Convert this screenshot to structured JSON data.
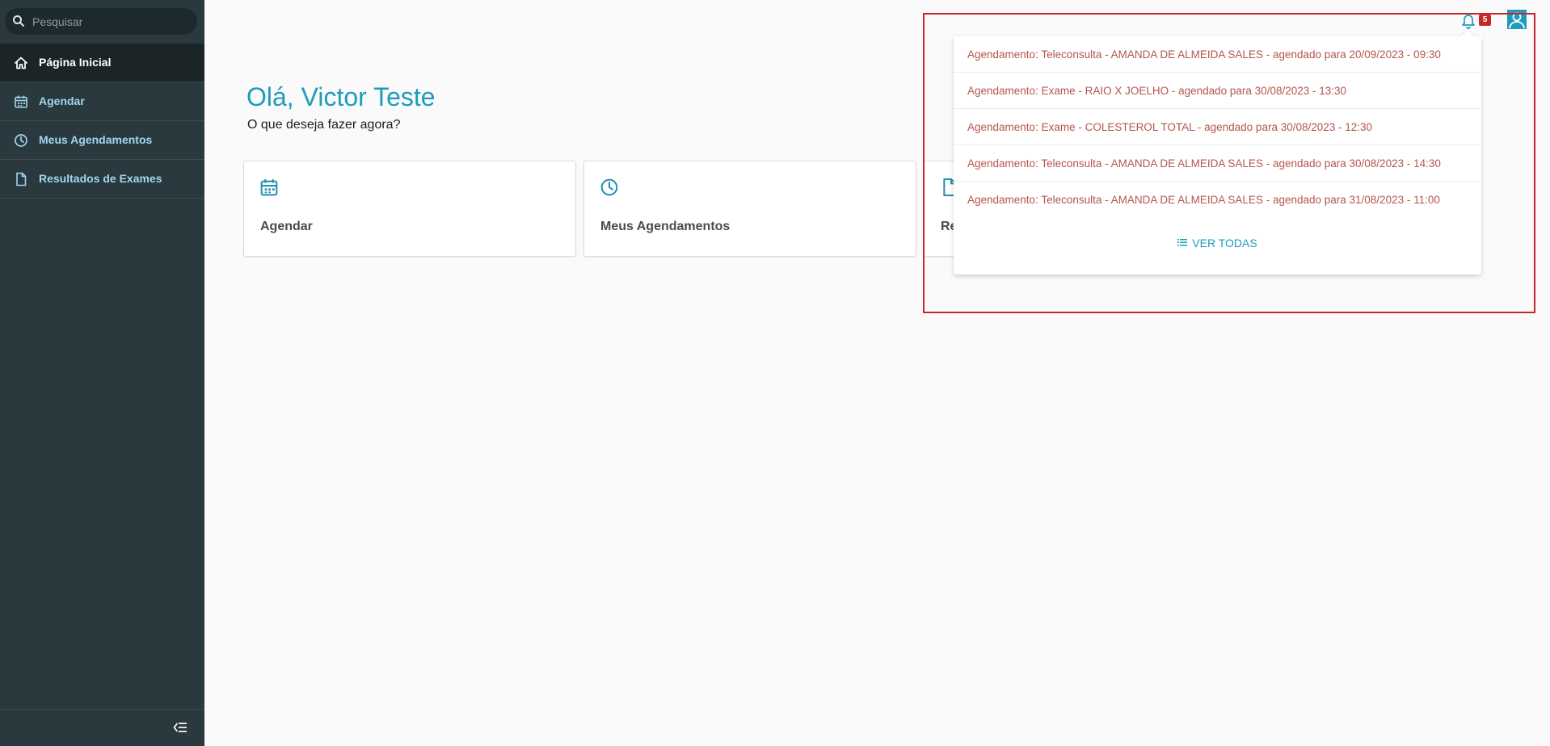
{
  "search": {
    "placeholder": "Pesquisar",
    "icon": "search-icon"
  },
  "sidebar": {
    "items": [
      {
        "label": "Página Inicial",
        "icon": "home-icon",
        "active": true
      },
      {
        "label": "Agendar",
        "icon": "calendar-icon",
        "active": false
      },
      {
        "label": "Meus Agendamentos",
        "icon": "clock-icon",
        "active": false
      },
      {
        "label": "Resultados de Exames",
        "icon": "document-icon",
        "active": false
      }
    ],
    "collapse_icon": "collapse-menu-icon"
  },
  "main": {
    "greeting": "Olá, Victor Teste",
    "subtitle": "O que deseja fazer agora?",
    "cards": [
      {
        "label": "Agendar",
        "icon": "calendar-icon"
      },
      {
        "label": "Meus Agendamentos",
        "icon": "clock-icon"
      },
      {
        "label": "Re",
        "icon": "document-icon"
      }
    ]
  },
  "header": {
    "bell_icon": "bell-icon",
    "badge_count": "5",
    "user_icon": "user-icon"
  },
  "notifications": {
    "items": [
      {
        "text": "Agendamento: Teleconsulta - AMANDA DE ALMEIDA SALES - agendado para 20/09/2023 - 09:30"
      },
      {
        "text": "Agendamento: Exame - RAIO X JOELHO - agendado para 30/08/2023 - 13:30"
      },
      {
        "text": "Agendamento: Exame - COLESTEROL TOTAL - agendado para 30/08/2023 - 12:30"
      },
      {
        "text": "Agendamento: Teleconsulta - AMANDA DE ALMEIDA SALES - agendado para 30/08/2023 - 14:30"
      },
      {
        "text": "Agendamento: Teleconsulta - AMANDA DE ALMEIDA SALES - agendado para 31/08/2023 - 11:00"
      }
    ],
    "view_all_label": "VER TODAS",
    "view_all_icon": "list-icon"
  },
  "colors": {
    "sidebar_bg": "#29393d",
    "accent": "#1e9bbd",
    "notification_text": "#b4554d",
    "badge": "#c62828",
    "highlight_border": "#c8242c"
  }
}
